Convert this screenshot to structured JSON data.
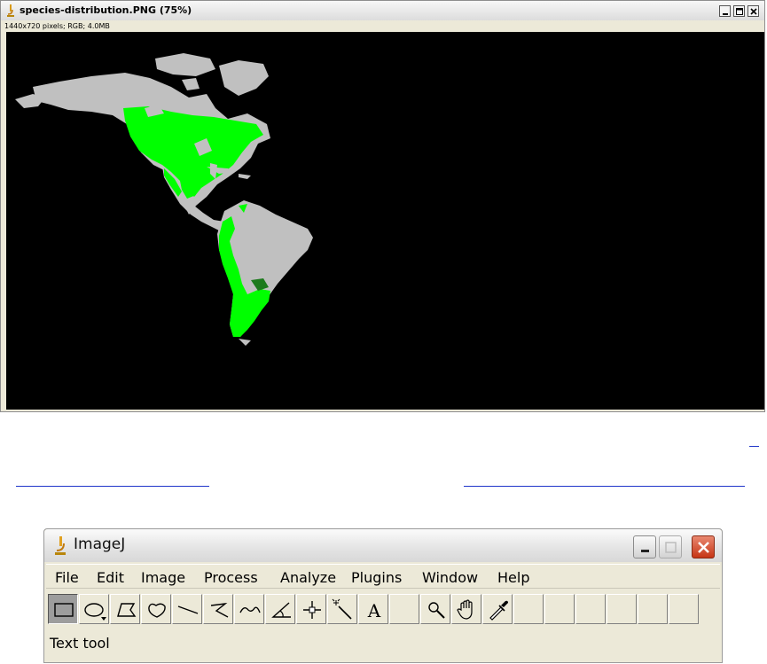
{
  "image_window": {
    "title": "species-distribution.PNG (75%)",
    "info": "1440x720 pixels; RGB; 4.0MB",
    "icon": "microscope-icon",
    "buttons": [
      "minimize-icon",
      "maximize-icon",
      "close-icon"
    ]
  },
  "imagej_window": {
    "title": "ImageJ",
    "icon": "microscope-icon",
    "menu": [
      "File",
      "Edit",
      "Image",
      "Process",
      "Analyze",
      "Plugins",
      "Window",
      "Help"
    ],
    "tools": [
      {
        "name": "rectangle-tool",
        "icon": "rectangle-icon",
        "active": true
      },
      {
        "name": "oval-tool",
        "icon": "oval-icon"
      },
      {
        "name": "polygon-tool",
        "icon": "polygon-icon"
      },
      {
        "name": "freehand-tool",
        "icon": "freehand-icon"
      },
      {
        "name": "straight-line-tool",
        "icon": "line-icon"
      },
      {
        "name": "segmented-line-tool",
        "icon": "segmented-line-icon"
      },
      {
        "name": "freehand-line-tool",
        "icon": "freehand-line-icon"
      },
      {
        "name": "angle-tool",
        "icon": "angle-icon"
      },
      {
        "name": "point-tool",
        "icon": "crosshair-icon"
      },
      {
        "name": "wand-tool",
        "icon": "wand-icon"
      },
      {
        "name": "text-tool",
        "icon": "letter-a-icon"
      },
      {
        "name": "empty-slot",
        "icon": ""
      },
      {
        "name": "magnifying-glass-tool",
        "icon": "magnifier-icon"
      },
      {
        "name": "scrolling-tool",
        "icon": "hand-icon"
      },
      {
        "name": "color-picker-tool",
        "icon": "eyedropper-icon"
      }
    ],
    "status": "Text tool"
  },
  "colors": {
    "map_background": "#000000",
    "land": "#c0c0c0",
    "species_presence": "#00ff00",
    "close_button": "#d0452a",
    "link": "#1f35c9"
  }
}
